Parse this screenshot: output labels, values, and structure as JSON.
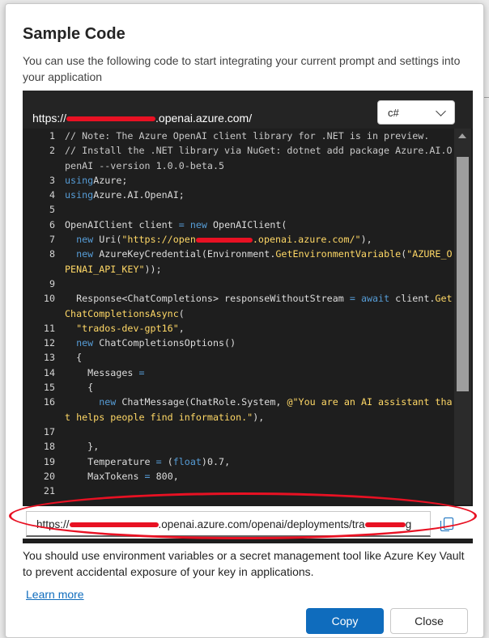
{
  "dialog": {
    "title": "Sample Code",
    "description": "You can use the following code to start integrating your current prompt and settings into your application"
  },
  "header": {
    "endpoint_prefix": "https://",
    "endpoint_suffix": ".openai.azure.com/",
    "language": "c#"
  },
  "code": {
    "lines": [
      {
        "n": "1",
        "s": [
          [
            "c-com",
            "// Note: The Azure OpenAI client library for .NET is in preview."
          ]
        ]
      },
      {
        "n": "2",
        "s": [
          [
            "c-com",
            "// Install the .NET library via NuGet: dotnet add package Azure.AI.OpenAI --version 1.0.0-beta.5"
          ]
        ]
      },
      {
        "n": "3",
        "s": [
          [
            "c-kw",
            "using"
          ],
          [
            "",
            "Azure;"
          ]
        ]
      },
      {
        "n": "4",
        "s": [
          [
            "c-kw",
            "using"
          ],
          [
            "",
            "Azure.AI.OpenAI;"
          ]
        ]
      },
      {
        "n": "5",
        "s": []
      },
      {
        "n": "6",
        "s": [
          [
            "",
            "OpenAIClient client "
          ],
          [
            "c-op",
            "="
          ],
          [
            "",
            " "
          ],
          [
            "c-kw",
            "new"
          ],
          [
            "",
            " OpenAIClient("
          ]
        ]
      },
      {
        "n": "7",
        "s": [
          [
            "",
            "  "
          ],
          [
            "c-kw",
            "new"
          ],
          [
            "",
            " Uri("
          ],
          [
            "c-str",
            "\"https://open"
          ],
          [
            "redact",
            ""
          ],
          [
            "c-str",
            ".openai.azure.com/\""
          ],
          [
            "",
            "),"
          ]
        ]
      },
      {
        "n": "8",
        "s": [
          [
            "",
            "  "
          ],
          [
            "c-kw",
            "new"
          ],
          [
            "",
            " AzureKeyCredential(Environment."
          ],
          [
            "c-fn",
            "GetEnvironmentVariable"
          ],
          [
            "",
            "("
          ],
          [
            "c-str",
            "\"AZURE_OPENAI_API_KEY\""
          ],
          [
            "",
            "));"
          ]
        ]
      },
      {
        "n": "9",
        "s": []
      },
      {
        "n": "10",
        "s": [
          [
            "",
            "  Response<ChatCompletions> responseWithoutStream "
          ],
          [
            "c-op",
            "="
          ],
          [
            "",
            " "
          ],
          [
            "c-kw",
            "await"
          ],
          [
            "",
            " client."
          ],
          [
            "c-fn",
            "GetChatCompletionsAsync"
          ],
          [
            "",
            "("
          ]
        ]
      },
      {
        "n": "11",
        "s": [
          [
            "",
            "  "
          ],
          [
            "c-str",
            "\"trados-dev-gpt16\""
          ],
          [
            "",
            ","
          ]
        ]
      },
      {
        "n": "12",
        "s": [
          [
            "",
            "  "
          ],
          [
            "c-kw",
            "new"
          ],
          [
            "",
            " ChatCompletionsOptions()"
          ]
        ]
      },
      {
        "n": "13",
        "s": [
          [
            "",
            "  {"
          ]
        ]
      },
      {
        "n": "14",
        "s": [
          [
            "",
            "    Messages "
          ],
          [
            "c-op",
            "="
          ]
        ]
      },
      {
        "n": "15",
        "s": [
          [
            "",
            "    {"
          ]
        ]
      },
      {
        "n": "16",
        "s": [
          [
            "",
            "      "
          ],
          [
            "c-kw",
            "new"
          ],
          [
            "",
            " ChatMessage(ChatRole.System, "
          ],
          [
            "c-str",
            "@\"You are an AI assistant that helps people find information.\""
          ],
          [
            "",
            "),"
          ]
        ]
      },
      {
        "n": "17",
        "s": []
      },
      {
        "n": "18",
        "s": [
          [
            "",
            "    },"
          ]
        ]
      },
      {
        "n": "19",
        "s": [
          [
            "",
            "    Temperature "
          ],
          [
            "c-op",
            "="
          ],
          [
            "",
            " ("
          ],
          [
            "c-kw",
            "float"
          ],
          [
            "",
            ")0.7,"
          ]
        ]
      },
      {
        "n": "20",
        "s": [
          [
            "",
            "    MaxTokens "
          ],
          [
            "c-op",
            "="
          ],
          [
            "",
            " 800,"
          ]
        ]
      },
      {
        "n": "21",
        "s": []
      }
    ]
  },
  "url_field": {
    "prefix": "https://",
    "middle": ".openai.azure.com/openai/deployments/tra",
    "suffix": "g"
  },
  "note": "You should use environment variables or a secret management tool like Azure Key Vault to prevent accidental exposure of your key in applications.",
  "learn_more": "Learn more",
  "buttons": {
    "copy": "Copy",
    "close": "Close"
  },
  "colors": {
    "accent": "#0f6cbd",
    "redaction": "#e81123",
    "editor_bg": "#1e1e1e"
  },
  "icons": {
    "copy": "copy-icon",
    "dropdown": "chevron-down-icon"
  }
}
